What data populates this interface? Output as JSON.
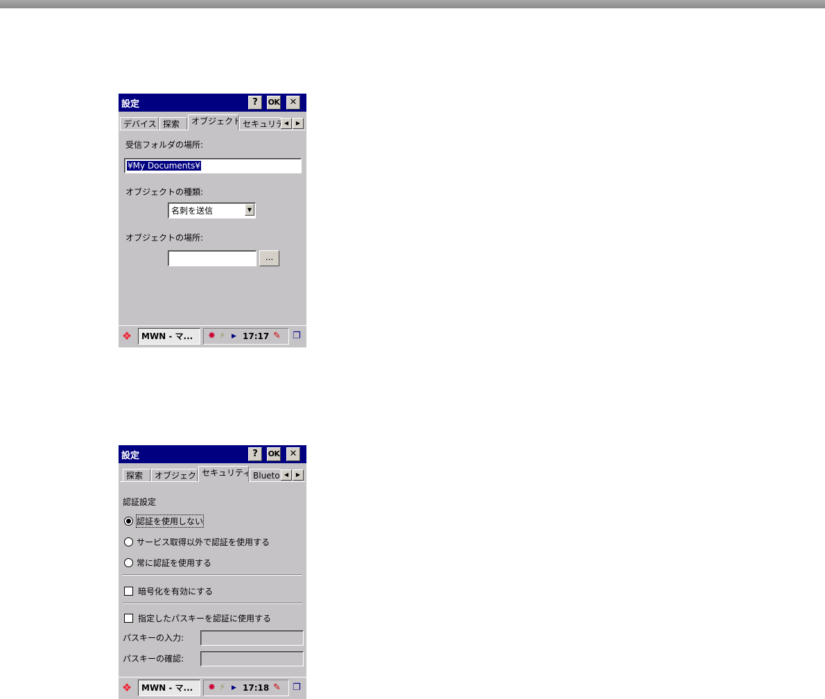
{
  "colors": {
    "titlebar": "#000080",
    "dialog": "#c6c3c6"
  },
  "screen1": {
    "title": "設定",
    "help_label": "?",
    "ok_label": "OK",
    "close_label": "✕",
    "tabs": [
      "デバイス",
      "探索",
      "オブジェクト",
      "セキュリティ"
    ],
    "active_tab": "オブジェクト",
    "inbox_label": "受信フォルダの場所:",
    "inbox_value": "¥My Documents¥",
    "object_type_label": "オブジェクトの種類:",
    "object_type_value": "名刺を送信",
    "object_location_label": "オブジェクトの場所:",
    "object_location_value": "",
    "browse_label": "...",
    "taskbar": {
      "task_label": "MWN - マ...",
      "clock": "17:17"
    }
  },
  "screen2": {
    "title": "設定",
    "help_label": "?",
    "ok_label": "OK",
    "close_label": "✕",
    "tabs": [
      "探索",
      "オブジェクト",
      "セキュリティ",
      "Blueto"
    ],
    "active_tab": "セキュリティ",
    "auth_group_label": "認証設定",
    "radio_options": [
      "認証を使用しない",
      "サービス取得以外で認証を使用する",
      "常に認証を使用する"
    ],
    "radio_selected": "認証を使用しない",
    "encrypt_label": "暗号化を有効にする",
    "encrypt_checked": false,
    "passkey_use_label": "指定したパスキーを認証に使用する",
    "passkey_use_checked": false,
    "passkey_input_label": "パスキーの入力:",
    "passkey_confirm_label": "パスキーの確認:",
    "taskbar": {
      "task_label": "MWN - マ...",
      "clock": "17:18"
    }
  }
}
